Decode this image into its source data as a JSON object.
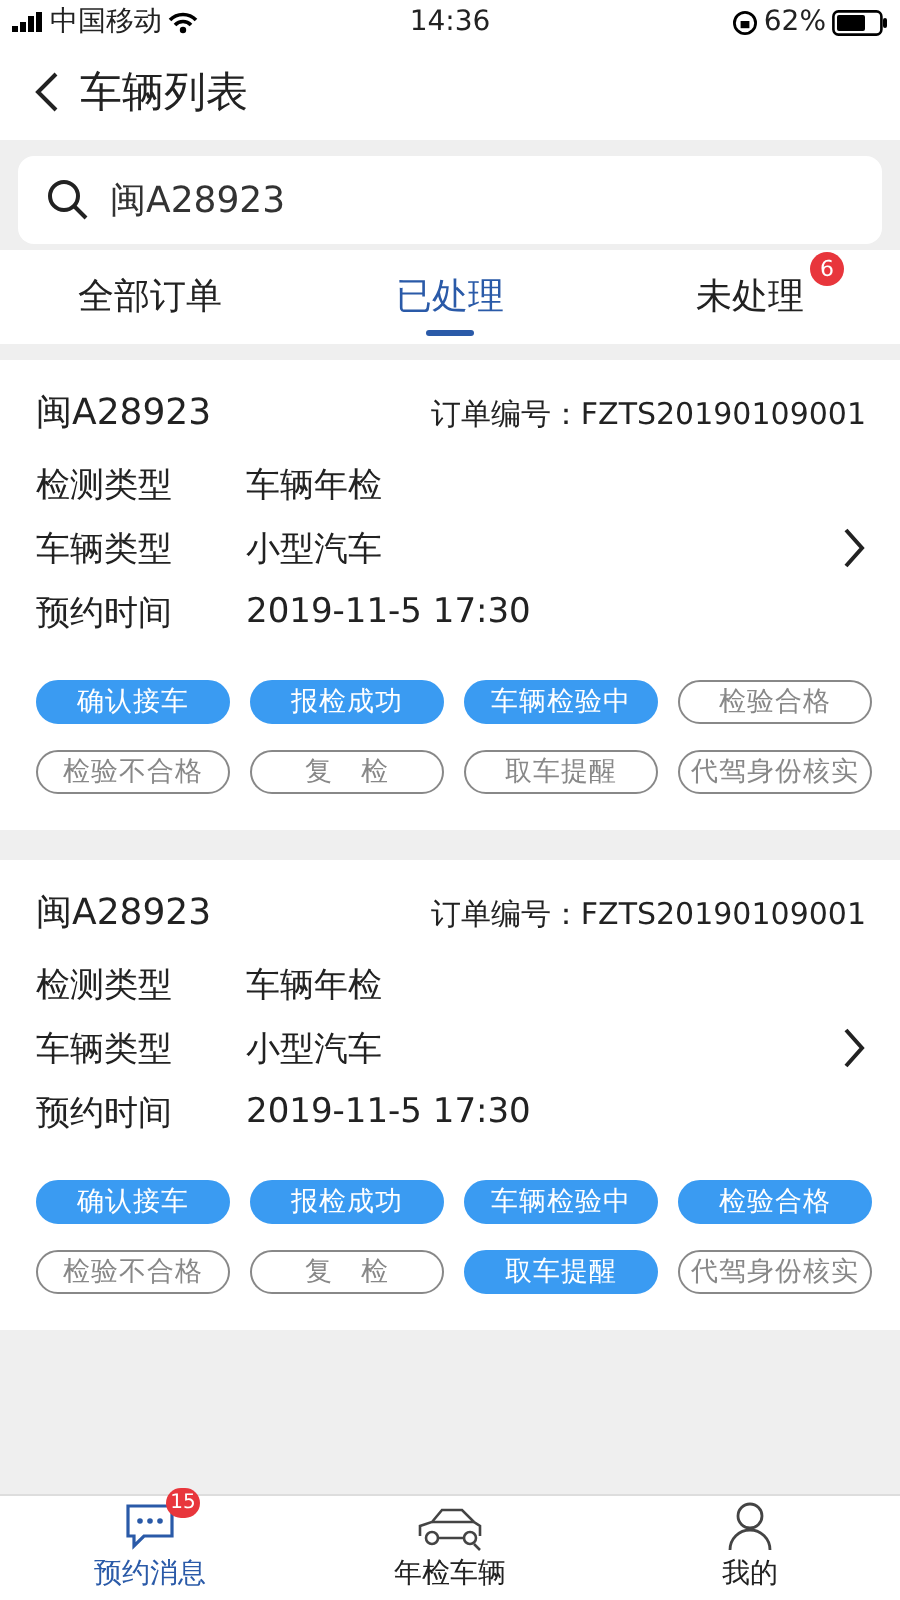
{
  "status_bar": {
    "carrier": "中国移动",
    "time": "14:36",
    "battery": "62%"
  },
  "header": {
    "title": "车辆列表"
  },
  "search": {
    "value": "闽A28923"
  },
  "tabs": [
    {
      "label": "全部订单",
      "selected": false
    },
    {
      "label": "已处理",
      "selected": true
    },
    {
      "label": "未处理",
      "selected": false,
      "badge": "6"
    }
  ],
  "orders": [
    {
      "plate": "闽A28923",
      "order_label": "订单编号：",
      "order_no": "FZTS20190109001",
      "fields": [
        {
          "label": "检测类型",
          "value": "车辆年检"
        },
        {
          "label": "车辆类型",
          "value": "小型汽车"
        },
        {
          "label": "预约时间",
          "value": "2019-11-5  17:30"
        }
      ],
      "steps": [
        {
          "label": "确认接车",
          "done": true
        },
        {
          "label": "报检成功",
          "done": true
        },
        {
          "label": "车辆检验中",
          "done": true
        },
        {
          "label": "检验合格",
          "done": false
        },
        {
          "label": "检验不合格",
          "done": false
        },
        {
          "label": "复　检",
          "done": false
        },
        {
          "label": "取车提醒",
          "done": false
        },
        {
          "label": "代驾身份核实",
          "done": false
        }
      ]
    },
    {
      "plate": "闽A28923",
      "order_label": "订单编号：",
      "order_no": "FZTS20190109001",
      "fields": [
        {
          "label": "检测类型",
          "value": "车辆年检"
        },
        {
          "label": "车辆类型",
          "value": "小型汽车"
        },
        {
          "label": "预约时间",
          "value": "2019-11-5  17:30"
        }
      ],
      "steps": [
        {
          "label": "确认接车",
          "done": true
        },
        {
          "label": "报检成功",
          "done": true
        },
        {
          "label": "车辆检验中",
          "done": true
        },
        {
          "label": "检验合格",
          "done": true
        },
        {
          "label": "检验不合格",
          "done": false
        },
        {
          "label": "复　检",
          "done": false
        },
        {
          "label": "取车提醒",
          "done": true
        },
        {
          "label": "代驾身份核实",
          "done": false
        }
      ]
    }
  ],
  "bottom_nav": [
    {
      "label": "预约消息",
      "selected": true,
      "badge": "15",
      "kind": "message"
    },
    {
      "label": "年检车辆",
      "selected": false,
      "kind": "car"
    },
    {
      "label": "我的",
      "selected": false,
      "kind": "person"
    }
  ]
}
